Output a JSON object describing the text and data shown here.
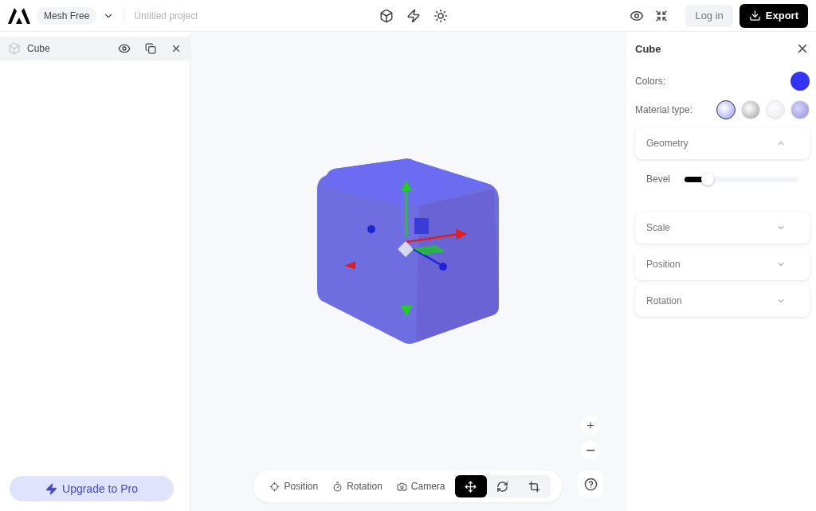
{
  "header": {
    "plan": "Mesh Free",
    "project": "Untitled project",
    "login": "Log in",
    "export": "Export"
  },
  "layers": [
    {
      "name": "Cube",
      "selected": true
    }
  ],
  "upgrade": "Upgrade to Pro",
  "viewport": {
    "modes": [
      {
        "kind": "position",
        "label": "Position"
      },
      {
        "kind": "rotation",
        "label": "Rotation"
      },
      {
        "kind": "camera",
        "label": "Camera"
      }
    ],
    "tools": [
      {
        "kind": "move",
        "selected": true
      },
      {
        "kind": "rotate",
        "selected": false
      },
      {
        "kind": "crop",
        "selected": false
      }
    ]
  },
  "inspector": {
    "title": "Cube",
    "colors_label": "Colors:",
    "color": "#3434f4",
    "material_label": "Material type:",
    "materials": [
      {
        "kind": "glossy",
        "selected": true
      },
      {
        "kind": "metal",
        "selected": false
      },
      {
        "kind": "glass",
        "selected": false
      },
      {
        "kind": "matte",
        "selected": false
      }
    ],
    "sections": [
      {
        "title": "Geometry",
        "expanded": true,
        "sliders": [
          {
            "label": "Bevel",
            "level": 0.2
          }
        ]
      },
      {
        "title": "Scale",
        "expanded": false
      },
      {
        "title": "Position",
        "expanded": false
      },
      {
        "title": "Rotation",
        "expanded": false
      }
    ]
  }
}
